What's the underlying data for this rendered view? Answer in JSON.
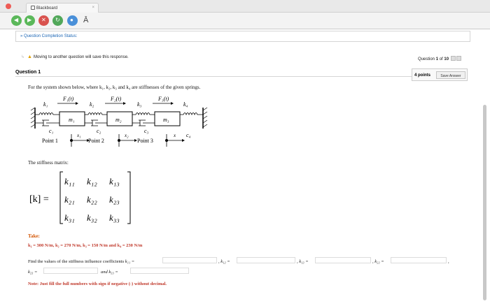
{
  "browser": {
    "tab_title": "Blackboard",
    "tab_close": "×",
    "toolbar_text": "Ā"
  },
  "status": {
    "text": "» Question Completion Status:"
  },
  "warning": {
    "text": "Moving to another question will save this response."
  },
  "counter": {
    "prefix": "Question ",
    "current": "1",
    "of": " of ",
    "total": "10"
  },
  "question": {
    "title": "Question 1",
    "points": "4 points",
    "save_label": "Save Answer",
    "prompt": "For the system shown below, where k₁, k₂, k₃ and k₄ are stiffnesses of the given springs.",
    "stiffness_label": "The stiffness matrix:",
    "take_label": "Take:",
    "given": "k₁ = 300 N/m,  k₂ = 270 N/m,  k₃ = 150 N/m  and  k₄ = 230 N/m",
    "find_prefix": "Find the values of the stiffness influence coefficients",
    "note": "Note: Just fill the full numbers with sign if negative (-) without decimal."
  },
  "diagram": {
    "springs": [
      "k₁",
      "k₂",
      "k₃",
      "k₄"
    ],
    "forces": [
      "F₁(t)",
      "F₂(t)",
      "F₃(t)"
    ],
    "masses": [
      "m₁",
      "m₂",
      "m₃"
    ],
    "dampers": [
      "c₁",
      "c₂",
      "c₃",
      "c₄"
    ],
    "points": [
      "Point 1",
      "Point 2",
      "Point 3"
    ],
    "displacements": [
      "x₁",
      "x₂",
      "x"
    ]
  },
  "matrix": {
    "lhs": "[k] =",
    "cells": [
      [
        "k₁₁",
        "k₁₂",
        "k₁₃"
      ],
      [
        "k₂₁",
        "k₂₂",
        "k₂₃"
      ],
      [
        "k₃₁",
        "k₃₂",
        "k₃₃"
      ]
    ]
  },
  "answers": {
    "k11_label": "k₁₁ =",
    "k12_label": ", k₁₂ =",
    "k13_label": ", k₁₃ =",
    "k22_label": ", k₂₂ =",
    "k23_label": "k₂₃ =",
    "k33_label": "and  k₃₃ =",
    "trailing_comma": ","
  }
}
